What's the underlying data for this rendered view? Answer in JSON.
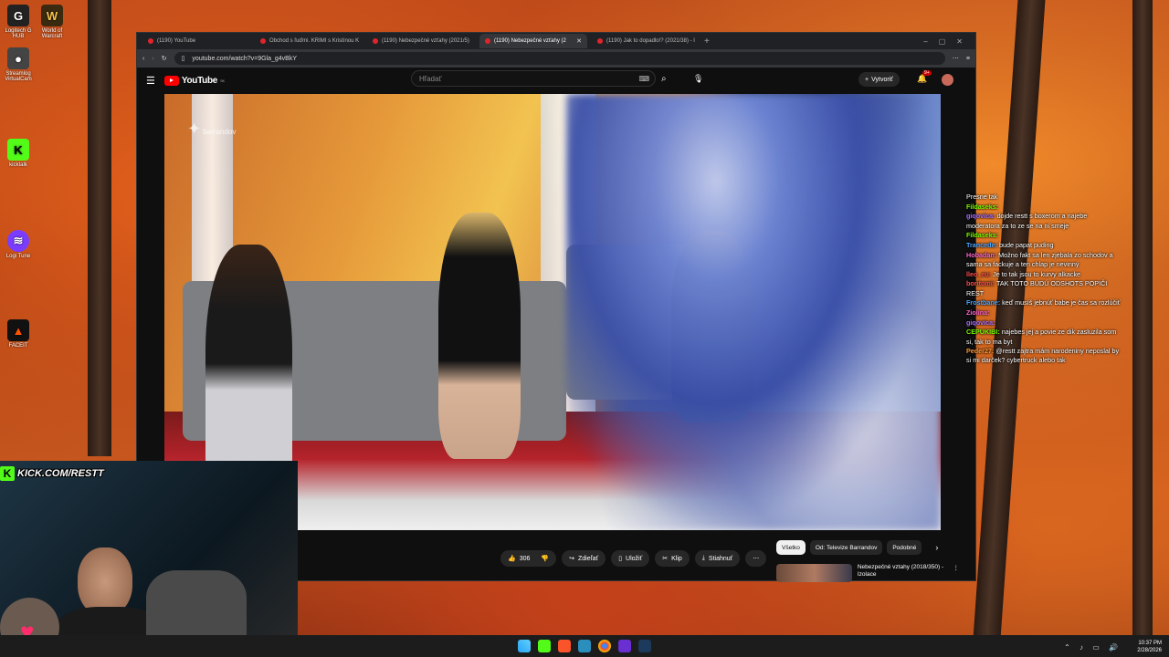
{
  "desktop": {
    "icons": [
      {
        "label": "Logitech G HUB"
      },
      {
        "label": "World of Warcraft"
      },
      {
        "label": "Streamlog VirtualCam"
      },
      {
        "label": "kicktalk"
      },
      {
        "label": "Logi Tune"
      },
      {
        "label": "FACEIT"
      }
    ]
  },
  "browser": {
    "tabs": [
      {
        "label": "(1190) YouTube"
      },
      {
        "label": "Obchod s ľuďmi. KRIMI s Kristínou K"
      },
      {
        "label": "(1190) Nebezpečné vzťahy (2021/5)"
      },
      {
        "label": "(1190) Nebezpečné vzťahy (2"
      },
      {
        "label": "(1190) Jak to dopadlo!? (2021/38) - I"
      }
    ],
    "url": "youtube.com/watch?v=9Gla_g4vBkY"
  },
  "youtube": {
    "logo": "YouTube",
    "logo_region": "SK",
    "search_placeholder": "Hľadať",
    "create_label": "Vytvoriť",
    "notif_count": "9+",
    "watermark": "barrandov",
    "actions": {
      "likes": "306",
      "share": "Zdieľať",
      "save": "Uložiť",
      "clip": "Klip",
      "download": "Stiahnuť"
    },
    "chips": [
      "Všetko",
      "Od: Televize Barrandov",
      "Podobné"
    ],
    "recommendation": {
      "title": "Nebezpečné vztahy (2018/350) - Izolace"
    }
  },
  "chat": [
    {
      "user": "",
      "text": "Presne tak",
      "color": "#ff4d4d"
    },
    {
      "user": "Fildaseks:",
      "text": "",
      "color": "#7cfc00"
    },
    {
      "user": "giqovica:",
      "text": "dojde restt s boxerom a najebe moderatora za to ze se na ni smeje",
      "color": "#a970ff"
    },
    {
      "user": "Fildaseks:",
      "text": "",
      "color": "#7cfc00"
    },
    {
      "user": "Trancede:",
      "text": "bude papat puding",
      "color": "#4da6ff"
    },
    {
      "user": "Hobadan:",
      "text": "Možno fakt sa len zjebala zo schodov a sama sa fackuje a ten chlap je nevinný",
      "color": "#ff66cc"
    },
    {
      "user": "lleo_eu:",
      "text": "Je to tak jsou to kurvy alkacke",
      "color": "#ff4d4d"
    },
    {
      "user": "boritomi:",
      "text": "TAK TOTO BUDÚ ODSHOTS POPIČI REST",
      "color": "#ff4d4d"
    },
    {
      "user": "Frostbane:",
      "text": "keď musíš jebnúť babe je čas sa rozlúčiť",
      "color": "#4da6ff"
    },
    {
      "user": "Ziolina:",
      "text": "",
      "color": "#ff66cc"
    },
    {
      "user": "giqovica:",
      "text": "",
      "color": "#a970ff"
    },
    {
      "user": "CEPUKIBI:",
      "text": "najebes jej a povie ze dik zasluzila som si, tak to ma byt",
      "color": "#7cfc00"
    },
    {
      "user": "Peder27:",
      "text": "@restt zajtra mám narodeniny neposlal by si mi darček? cybertruck alebo tak",
      "color": "#ff9933"
    }
  ],
  "webcam": {
    "banner": "KICK.COM/RESTT"
  },
  "taskbar": {
    "time": "10:37 PM",
    "date": "2/28/2026"
  }
}
